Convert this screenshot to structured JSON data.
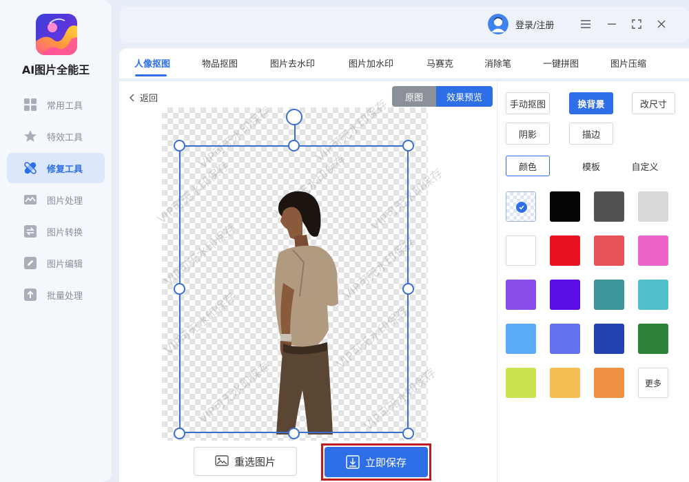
{
  "app": {
    "name": "AI图片全能王"
  },
  "sidebar": {
    "items": [
      {
        "label": "常用工具",
        "icon": "grid-icon"
      },
      {
        "label": "特效工具",
        "icon": "star-icon"
      },
      {
        "label": "修复工具",
        "icon": "bandage-icon",
        "active": true
      },
      {
        "label": "图片处理",
        "icon": "image-icon"
      },
      {
        "label": "图片转换",
        "icon": "convert-icon"
      },
      {
        "label": "图片编辑",
        "icon": "edit-icon"
      },
      {
        "label": "批量处理",
        "icon": "upload-icon"
      }
    ]
  },
  "header": {
    "login_label": "登录/注册",
    "controls": [
      "menu-icon",
      "minimize-icon",
      "maximize-icon",
      "close-icon"
    ]
  },
  "tabs": [
    {
      "label": "人像抠图",
      "active": true
    },
    {
      "label": "物品抠图"
    },
    {
      "label": "图片去水印"
    },
    {
      "label": "图片加水印"
    },
    {
      "label": "马赛克"
    },
    {
      "label": "消除笔"
    },
    {
      "label": "一键拼图"
    },
    {
      "label": "图片压缩"
    }
  ],
  "editor": {
    "back_label": "返回",
    "toggle": {
      "original": "原图",
      "preview": "效果预览",
      "selected": "preview"
    },
    "watermark_text": "VIP可无水印保存",
    "reselect_label": "重选图片",
    "save_label": "立即保存"
  },
  "panel": {
    "options": [
      {
        "label": "手动抠图"
      },
      {
        "label": "换背景",
        "active": true
      },
      {
        "label": "改尺寸"
      },
      {
        "label": "阴影"
      },
      {
        "label": "描边"
      }
    ],
    "sub_tabs": [
      {
        "label": "颜色",
        "active": true
      },
      {
        "label": "模板"
      },
      {
        "label": "自定义"
      }
    ],
    "colors": [
      "transparent",
      "#050505",
      "#525252",
      "#d9d9d9",
      "#ffffff",
      "#e8121e",
      "#e85158",
      "#ec63c9",
      "#8b4de8",
      "#5b0ee6",
      "#3b979a",
      "#4fbfcb",
      "#5aabf5",
      "#6472f0",
      "#2041ae",
      "#2c8237",
      "#cde251",
      "#f3bf55",
      "#ef9244"
    ],
    "selected_color": "transparent",
    "more_label": "更多"
  }
}
